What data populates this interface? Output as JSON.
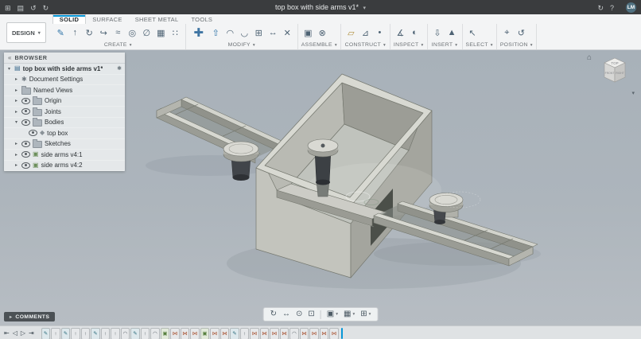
{
  "colors": {
    "accent": "#0696d7",
    "topbar_bg": "#3a3c3e",
    "ribbon_bg": "#f3f4f5",
    "canvas_top": "#a8b1b9",
    "canvas_bottom": "#b7bdc3",
    "model_body": "#c6c7c0"
  },
  "ui": {
    "caret_down": "▾",
    "caret_right": "▸"
  },
  "topbar": {
    "left_icons": [
      {
        "name": "data-panel-grid-icon",
        "glyph": "⊞"
      },
      {
        "name": "file-menu-icon",
        "glyph": "▤"
      },
      {
        "name": "undo-icon",
        "glyph": "↺"
      },
      {
        "name": "redo-icon",
        "glyph": "↻"
      }
    ],
    "document_title": "top box with side arms v1*",
    "right_icons": [
      {
        "name": "job-status-icon",
        "glyph": "↻"
      },
      {
        "name": "help-icon",
        "glyph": "?"
      }
    ],
    "avatar_initials": "LM"
  },
  "ribbon": {
    "workspace_label": "DESIGN",
    "tabs": [
      {
        "label": "SOLID",
        "active": true
      },
      {
        "label": "SURFACE",
        "active": false
      },
      {
        "label": "SHEET METAL",
        "active": false
      },
      {
        "label": "TOOLS",
        "active": false
      }
    ],
    "groups": [
      {
        "label": "CREATE",
        "icons": [
          {
            "name": "create-sketch-icon",
            "glyph": "✎",
            "color": "#2f74a8"
          },
          {
            "name": "extrude-icon",
            "glyph": "↑",
            "color": "#4e6374"
          },
          {
            "name": "revolve-icon",
            "glyph": "↻",
            "color": "#4e6374"
          },
          {
            "name": "sweep-icon",
            "glyph": "↪",
            "color": "#4e6374"
          },
          {
            "name": "loft-icon",
            "glyph": "≈",
            "color": "#4e6374"
          },
          {
            "name": "hole-icon",
            "glyph": "◎",
            "color": "#4e6374"
          },
          {
            "name": "thread-icon",
            "glyph": "∅",
            "color": "#4e6374"
          },
          {
            "name": "primitive-box-icon",
            "glyph": "▦",
            "color": "#4e6374"
          },
          {
            "name": "pattern-icon",
            "glyph": "∷",
            "color": "#4e6374"
          }
        ]
      },
      {
        "label": "MODIFY",
        "icons": [
          {
            "name": "move-copy-icon",
            "glyph": "✚",
            "color": "#3f75a3",
            "big": true
          },
          {
            "name": "press-pull-icon",
            "glyph": "⇧",
            "color": "#2f74a8"
          },
          {
            "name": "fillet-icon",
            "glyph": "◠",
            "color": "#4e6374"
          },
          {
            "name": "shell-icon",
            "glyph": "◡",
            "color": "#4e6374"
          },
          {
            "name": "combine-icon",
            "glyph": "⊞",
            "color": "#4e6374"
          },
          {
            "name": "offset-face-icon",
            "glyph": "↔",
            "color": "#4e6374"
          },
          {
            "name": "delete-icon",
            "glyph": "✕",
            "color": "#4e6374"
          }
        ]
      },
      {
        "label": "ASSEMBLE",
        "icons": [
          {
            "name": "new-component-icon",
            "glyph": "▣",
            "color": "#4e6374"
          },
          {
            "name": "joint-icon",
            "glyph": "⊗",
            "color": "#4e6374"
          }
        ]
      },
      {
        "label": "CONSTRUCT",
        "icons": [
          {
            "name": "offset-plane-icon",
            "glyph": "▱",
            "color": "#b08f3c"
          },
          {
            "name": "construct-axis-icon",
            "glyph": "⊿",
            "color": "#4e6374"
          },
          {
            "name": "construct-point-icon",
            "glyph": "•",
            "color": "#4e6374"
          }
        ]
      },
      {
        "label": "INSPECT",
        "icons": [
          {
            "name": "measure-icon",
            "glyph": "∡",
            "color": "#4e6374"
          },
          {
            "name": "section-analysis-icon",
            "glyph": "◐",
            "color": "#4e6374"
          }
        ]
      },
      {
        "label": "INSERT",
        "icons": [
          {
            "name": "insert-derive-icon",
            "glyph": "⇩",
            "color": "#4e6374"
          },
          {
            "name": "insert-mesh-icon",
            "glyph": "▲",
            "color": "#4e6374"
          }
        ]
      },
      {
        "label": "SELECT",
        "icons": [
          {
            "name": "select-cursor-icon",
            "glyph": "↖",
            "color": "#4e6374"
          }
        ]
      },
      {
        "label": "POSITION",
        "icons": [
          {
            "name": "capture-position-icon",
            "glyph": "⌖",
            "color": "#4e6374"
          },
          {
            "name": "revert-position-icon",
            "glyph": "↺",
            "color": "#4e6374"
          }
        ]
      }
    ]
  },
  "browser": {
    "collapse_glyph": "«",
    "title": "BROWSER",
    "items": [
      {
        "label": "top box with side arms v1*",
        "level": 0,
        "caret": "▾",
        "eye": false,
        "icon": "document",
        "bold": true,
        "trailing": true
      },
      {
        "label": "Document Settings",
        "level": 1,
        "caret": "▸",
        "eye": false,
        "icon": "gear"
      },
      {
        "label": "Named Views",
        "level": 1,
        "caret": "▸",
        "eye": false,
        "icon": "folder"
      },
      {
        "label": "Origin",
        "level": 1,
        "caret": "▸",
        "eye": true,
        "icon": "folder"
      },
      {
        "label": "Joints",
        "level": 1,
        "caret": "▸",
        "eye": true,
        "icon": "folder"
      },
      {
        "label": "Bodies",
        "level": 1,
        "caret": "▾",
        "eye": true,
        "icon": "folder"
      },
      {
        "label": "top box",
        "level": 2,
        "caret": "",
        "eye": true,
        "icon": "body"
      },
      {
        "label": "Sketches",
        "level": 1,
        "caret": "▸",
        "eye": true,
        "icon": "folder"
      },
      {
        "label": "side arms v4:1",
        "level": 1,
        "caret": "▸",
        "eye": true,
        "icon": "component-link"
      },
      {
        "label": "side arms v4:2",
        "level": 1,
        "caret": "▸",
        "eye": true,
        "icon": "component-link"
      }
    ]
  },
  "viewcube": {
    "home_glyph": "⌂",
    "top_label": "TOP",
    "front_label": "FRONT",
    "right_label": "RIGHT"
  },
  "navbar": {
    "items": [
      {
        "name": "orbit-icon",
        "glyph": "↻"
      },
      {
        "name": "pan-icon",
        "glyph": "↔"
      },
      {
        "name": "zoom-icon",
        "glyph": "⊙"
      },
      {
        "name": "fit-view-icon",
        "glyph": "⊡"
      },
      {
        "separator": true
      },
      {
        "name": "display-settings-menu",
        "glyph": "▣",
        "caret": true
      },
      {
        "name": "grid-and-snaps-menu",
        "glyph": "▦",
        "caret": true
      },
      {
        "name": "viewports-menu",
        "glyph": "⊞",
        "caret": true
      }
    ]
  },
  "comments": {
    "label": "COMMENTS",
    "icon_glyph": "▸"
  },
  "timeline": {
    "controls": [
      {
        "name": "timeline-go-to-start-icon",
        "glyph": "⇤"
      },
      {
        "name": "timeline-step-back-icon",
        "glyph": "◁"
      },
      {
        "name": "timeline-play-icon",
        "glyph": "▷"
      },
      {
        "name": "timeline-go-to-end-icon",
        "glyph": "⇥"
      }
    ],
    "feature_styles": {
      "sketch": {
        "glyph": "✎",
        "color": "#2e6e7e",
        "bg": "#dde8ec"
      },
      "extrude": {
        "glyph": "↑",
        "color": "#5a626a",
        "bg": "#e6e8ea"
      },
      "modify": {
        "glyph": "◠",
        "color": "#5a626a",
        "bg": "#e6e8ea"
      },
      "component": {
        "glyph": "▣",
        "color": "#57803f",
        "bg": "#e2eadb"
      },
      "joint": {
        "glyph": "⋈",
        "color": "#a8502f",
        "bg": "#e6e8ea"
      }
    },
    "features": [
      "sketch",
      "extrude",
      "sketch",
      "extrude",
      "extrude",
      "sketch",
      "extrude",
      "extrude",
      "modify",
      "sketch",
      "extrude",
      "modify",
      "component",
      "joint",
      "joint",
      "joint",
      "component",
      "joint",
      "joint",
      "sketch",
      "extrude",
      "joint",
      "joint",
      "joint",
      "joint",
      "modify",
      "joint",
      "joint",
      "joint",
      "joint"
    ]
  }
}
